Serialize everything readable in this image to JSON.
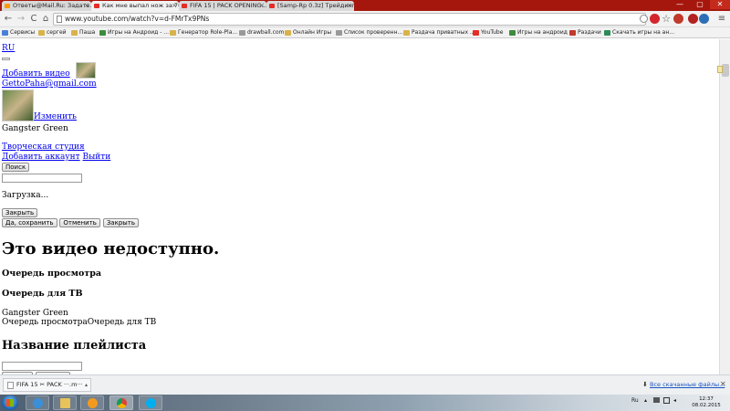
{
  "browser": {
    "tabs": [
      {
        "title": "Ответы@Mail.Ru: Задате...",
        "favicon_color": "#ff9900",
        "active": false
      },
      {
        "title": "Как мне выпал нож за 7(...",
        "favicon_color": "#e52d27",
        "active": true
      },
      {
        "title": "FIFA 15 | PACK OPENING...",
        "favicon_color": "#e52d27",
        "active": false
      },
      {
        "title": "[Samp-Rp 0.3z] Трейдинг...",
        "favicon_color": "#e52d27",
        "active": false
      }
    ],
    "window_controls": [
      "—",
      "▢",
      "✕"
    ],
    "address": "www.youtube.com/watch?v=d-FMrTx9PNs",
    "nav": {
      "back": "←",
      "forward": "→",
      "reload": "C",
      "home": "⌂"
    },
    "star": "☆",
    "menu": "≡",
    "bookmarks": [
      {
        "label": "Сервисы",
        "color": "#4a7fd9"
      },
      {
        "label": "сергей",
        "color": "#d9b24a"
      },
      {
        "label": "Паша",
        "color": "#d9b24a"
      },
      {
        "label": "Игры на Андроид - ...",
        "color": "#3c8c3c"
      },
      {
        "label": "Генератор Role-Pla...",
        "color": "#d9b24a"
      },
      {
        "label": "drawball.com",
        "color": "#999999"
      },
      {
        "label": "Онлайн Игры",
        "color": "#d9b24a"
      },
      {
        "label": "Список проверенн...",
        "color": "#999999"
      },
      {
        "label": "Раздача приватных ...",
        "color": "#d9b24a"
      },
      {
        "label": "YouTube",
        "color": "#e52d27"
      },
      {
        "label": "Игры на андроид",
        "color": "#3c8c3c"
      },
      {
        "label": "Раздачи",
        "color": "#c0392b"
      },
      {
        "label": "Скачать игры на ан...",
        "color": "#2e8b57"
      }
    ]
  },
  "page": {
    "lang_link": "RU",
    "add_video_link": "Добавить видео",
    "email_link": "GettoPaha@gmail.com",
    "change_link": "Изменить",
    "user_name": "Gangster Green",
    "creative_studio_link": "Творческая студия",
    "add_account_link": "Добавить аккаунт",
    "logout_link": "Выйти",
    "search_button": "Поиск",
    "loading_text": "Загрузка...",
    "close_button": "Закрыть",
    "yes_save_button": "Да, сохранить",
    "cancel_button": "Отменить",
    "close_button_2": "Закрыть",
    "unavailable_heading": "Это видео недоступно.",
    "watch_queue_heading": "Очередь просмотра",
    "tv_queue_heading": "Очередь для ТВ",
    "user_name_2": "Gangster Green",
    "queue_line": "Очередь просмотраОчередь для ТВ",
    "playlist_heading": "Название плейлиста"
  },
  "downloads": {
    "item_label": "FIFA 15 ✂ PACK ···.m···",
    "show_all": "Все скачанные файлы...",
    "close": "✕"
  },
  "taskbar": {
    "lang": "Ru",
    "time": "12:37",
    "date": "08.02.2015"
  }
}
